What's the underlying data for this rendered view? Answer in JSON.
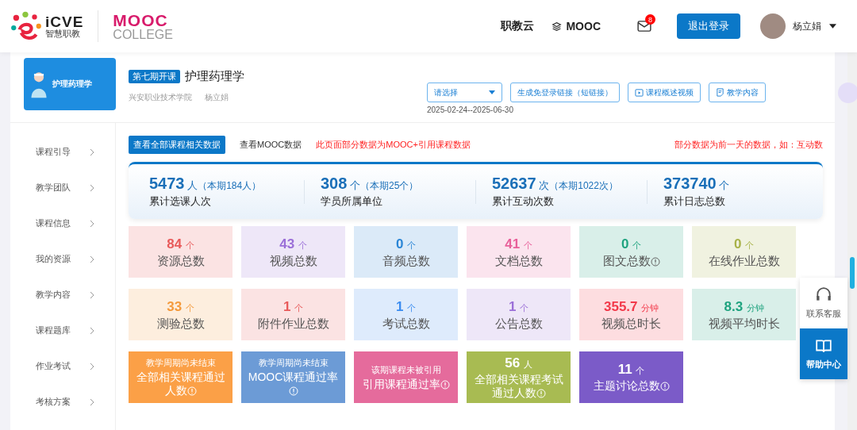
{
  "header": {
    "logo_brand": "iCVE",
    "logo_sub": "智慧职教",
    "mooc_logo": "MOOC",
    "mooc_sub": "COLLEGE",
    "nav": [
      "职教云",
      "MOOC"
    ],
    "mail_badge": "8",
    "logout": "退出登录",
    "user": "杨立娟"
  },
  "course": {
    "cover_title": "护理药理学",
    "term_tag": "第七期开课",
    "title": "护理药理学",
    "school": "兴安职业技术学院",
    "teacher": "杨立娟",
    "select_placeholder": "请选择",
    "actions": [
      {
        "label": "生成免登录链接（短链接）",
        "kind": "plain"
      },
      {
        "label": "课程概述视频",
        "kind": "video"
      },
      {
        "label": "教学内容",
        "kind": "doc"
      }
    ],
    "date_range": "2025-02-24--2025-06-30"
  },
  "sidebar": {
    "items": [
      "课程引导",
      "教学团队",
      "课程信息",
      "我的资源",
      "教学内容",
      "课程题库",
      "作业考试",
      "考核方案"
    ]
  },
  "tabs": [
    {
      "label": "查看全部课程相关数据",
      "selected": true
    },
    {
      "label": "查看MOOC数据",
      "selected": false
    }
  ],
  "notice_left": "此页面部分数据为MOOC+引用课程数据",
  "notice_right": "部分数据为前一天的数据，如：互动数",
  "summary": [
    {
      "value": "5473",
      "unit": "人",
      "extra": "（本期184人）",
      "label": "累计选课人次"
    },
    {
      "value": "308",
      "unit": "个",
      "extra": "（本期25个）",
      "label": "学员所属单位"
    },
    {
      "value": "52637",
      "unit": "次",
      "extra": "（本期1022次）",
      "label": "累计互动次数"
    },
    {
      "value": "373740",
      "unit": "个",
      "label": "累计日志总数"
    }
  ],
  "tiles": [
    {
      "kind": "light",
      "value": "84",
      "unit": "个",
      "label": "资源总数",
      "info": false,
      "color": "#e85a5a"
    },
    {
      "kind": "light",
      "value": "43",
      "unit": "个",
      "label": "视频总数",
      "info": false,
      "color": "#9b6fd8"
    },
    {
      "kind": "light",
      "value": "0",
      "unit": "个",
      "label": "音频总数",
      "info": false,
      "color": "#2b86d6"
    },
    {
      "kind": "light",
      "value": "41",
      "unit": "个",
      "label": "文档总数",
      "info": false,
      "color": "#e8609a"
    },
    {
      "kind": "light",
      "value": "0",
      "unit": "个",
      "label": "图文总数",
      "info": true,
      "color": "#1fa37f"
    },
    {
      "kind": "light",
      "value": "0",
      "unit": "个",
      "label": "在线作业总数",
      "info": false,
      "color": "#a8b248"
    },
    {
      "kind": "light",
      "value": "33",
      "unit": "个",
      "label": "测验总数",
      "info": false,
      "color": "#f49a3c"
    },
    {
      "kind": "light",
      "value": "1",
      "unit": "个",
      "label": "附件作业总数",
      "info": false,
      "color": "#e85a5a"
    },
    {
      "kind": "light",
      "value": "1",
      "unit": "个",
      "label": "考试总数",
      "info": false,
      "color": "#3b8cf0"
    },
    {
      "kind": "light",
      "value": "1",
      "unit": "个",
      "label": "公告总数",
      "info": false,
      "color": "#9b6fd8"
    },
    {
      "kind": "light",
      "value": "355.7",
      "unit": "分钟",
      "label": "视频总时长",
      "info": false,
      "color": "#f2394a"
    },
    {
      "kind": "light",
      "value": "8.3",
      "unit": "分钟",
      "label": "视频平均时长",
      "info": false,
      "color": "#1fa37f"
    },
    {
      "kind": "solid",
      "note": "教学周期尚未结束",
      "label": "全部相关课程通过人数",
      "info": true,
      "color": "#fba047"
    },
    {
      "kind": "solid",
      "note": "教学周期尚未结束",
      "label": "MOOC课程通过率",
      "info": true,
      "color": "#6c9bd6"
    },
    {
      "kind": "solid",
      "note": "该期课程未被引用",
      "label": "引用课程通过率",
      "info": true,
      "color": "#e56b9c"
    },
    {
      "kind": "solid",
      "value": "56",
      "unit": "人",
      "label": "全部相关课程考试通过人数",
      "info": true,
      "color": "#a8bb52"
    },
    {
      "kind": "solid",
      "value": "11",
      "unit": "个",
      "label": "主题讨论总数",
      "info": true,
      "color": "#7b5bc8"
    }
  ],
  "float_panel": [
    {
      "label": "联系客服",
      "kind": "support"
    },
    {
      "label": "帮助中心",
      "kind": "help"
    }
  ]
}
